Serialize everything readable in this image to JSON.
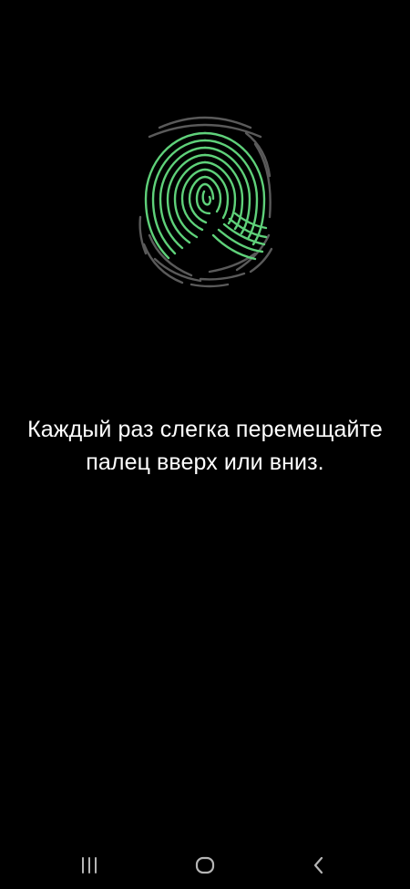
{
  "enrollment": {
    "instruction": "Каждый раз слегка перемещайте палец вверх или вниз.",
    "progress_color": "#5fd17a",
    "pending_color": "#5a5a5a",
    "icon": "fingerprint-icon"
  },
  "navbar": {
    "recent_icon": "recent-apps-icon",
    "home_icon": "home-icon",
    "back_icon": "back-icon",
    "icon_color": "#b5b5b5"
  }
}
